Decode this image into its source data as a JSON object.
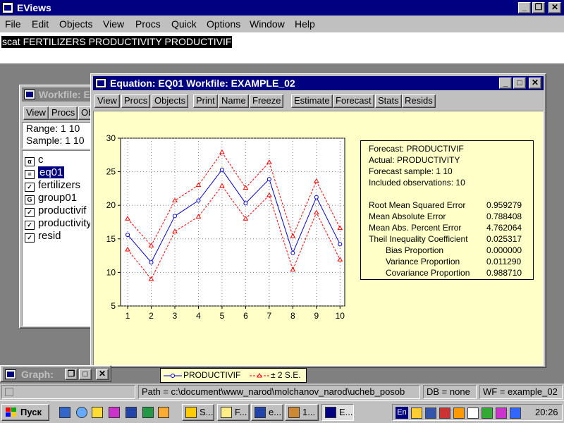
{
  "app": {
    "title": "EViews"
  },
  "menu": [
    "File",
    "Edit",
    "Objects",
    "View",
    "Procs",
    "Quick",
    "Options",
    "Window",
    "Help"
  ],
  "command": {
    "text": "scat FERTILIZERS PRODUCTIVITY PRODUCTIVIF"
  },
  "workfile": {
    "title": "Workfile: E",
    "toolbar": [
      "View",
      "Procs",
      "Ob"
    ],
    "range": "Range:   1 10",
    "sample": "Sample:  1 10",
    "objects": [
      {
        "name": "c",
        "icon": "coef-icon",
        "glyph": "α"
      },
      {
        "name": "eq01",
        "icon": "equation-icon",
        "glyph": "="
      },
      {
        "name": "fertilizers",
        "icon": "series-icon",
        "glyph": "✓"
      },
      {
        "name": "group01",
        "icon": "group-icon",
        "glyph": "G"
      },
      {
        "name": "productivif",
        "icon": "series-icon",
        "glyph": "✓"
      },
      {
        "name": "productivity",
        "icon": "series-icon",
        "glyph": "✓"
      },
      {
        "name": "resid",
        "icon": "series-icon",
        "glyph": "✓"
      }
    ]
  },
  "equation": {
    "title": "Equation: EQ01   Workfile: EXAMPLE_02",
    "toolbar": [
      "View",
      "Procs",
      "Objects",
      "Print",
      "Name",
      "Freeze",
      "Estimate",
      "Forecast",
      "Stats",
      "Resids"
    ]
  },
  "stats": {
    "header": [
      "Forecast: PRODUCTIVIF",
      "Actual: PRODUCTIVITY",
      "Forecast sample: 1 10",
      "Included observations: 10"
    ],
    "rows": [
      {
        "label": "Root Mean Squared Error",
        "value": "0.959279",
        "indent": false
      },
      {
        "label": "Mean Absolute Error",
        "value": "0.788408",
        "indent": false
      },
      {
        "label": "Mean Abs. Percent Error",
        "value": "4.762064",
        "indent": false
      },
      {
        "label": "Theil Inequality Coefficient",
        "value": "0.025317",
        "indent": false
      },
      {
        "label": "Bias Proportion",
        "value": "0.000000",
        "indent": true
      },
      {
        "label": "Variance Proportion",
        "value": "0.011290",
        "indent": true
      },
      {
        "label": "Covariance Proportion",
        "value": "0.988710",
        "indent": true
      }
    ]
  },
  "chart_data": {
    "type": "line",
    "x": [
      1,
      2,
      3,
      4,
      5,
      6,
      7,
      8,
      9,
      10
    ],
    "series": [
      {
        "name": "PRODUCTIVIF",
        "values": [
          15.6,
          11.5,
          18.4,
          20.7,
          25.3,
          20.3,
          23.9,
          12.9,
          21.2,
          14.2
        ],
        "color": "#0000cc"
      },
      {
        "name": "± 2 S.E.",
        "role": "upper",
        "values": [
          18.0,
          14.0,
          20.7,
          23.0,
          27.9,
          22.6,
          26.4,
          15.4,
          23.6,
          16.6
        ],
        "color": "#ff0000"
      },
      {
        "name": "± 2 S.E.",
        "role": "lower",
        "values": [
          13.4,
          9.0,
          16.1,
          18.3,
          22.9,
          18.0,
          21.5,
          10.4,
          18.9,
          11.9
        ],
        "color": "#ff0000"
      }
    ],
    "yticks": [
      5,
      10,
      15,
      20,
      25,
      30
    ],
    "xticks": [
      1,
      2,
      3,
      4,
      5,
      6,
      7,
      8,
      9,
      10
    ],
    "ylim": [
      5,
      30
    ],
    "xlim": [
      0.7,
      10.2
    ],
    "grid": true,
    "legend": "bottom"
  },
  "graph_window": {
    "title": "Graph:"
  },
  "status": {
    "path": "Path = c:\\document\\www_narod\\molchanov_narod\\ucheb_posob",
    "db": "DB = none",
    "wf": "WF = example_02"
  },
  "taskbar": {
    "start": "Пуск",
    "tasks": [
      {
        "label": "S...",
        "icon": "app-icon"
      },
      {
        "label": "F...",
        "icon": "app-icon"
      },
      {
        "label": "e...",
        "icon": "word-icon"
      },
      {
        "label": "1...",
        "icon": "app-icon"
      },
      {
        "label": "E...",
        "icon": "eviews-icon"
      }
    ],
    "lang": "En",
    "clock": "20:26"
  }
}
